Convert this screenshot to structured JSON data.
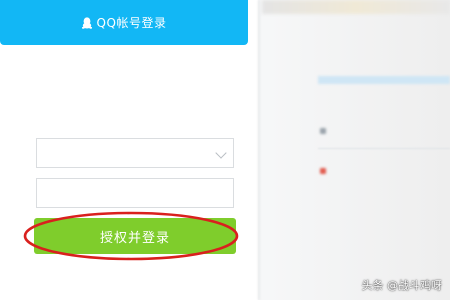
{
  "header": {
    "title": "QQ帐号登录"
  },
  "form": {
    "app_title": "",
    "auth_prefix": "",
    "auth_link": "",
    "auth_suffix": "",
    "account_placeholder": "",
    "password_placeholder": "",
    "login_button_label": "授权并登录"
  },
  "footer": {
    "links": [
      "",
      "",
      ""
    ]
  },
  "right_panel": {
    "line1": "",
    "line2": "",
    "line3": ""
  },
  "watermark": {
    "text": "头条 @战斗鸡呀"
  },
  "colors": {
    "header_blue": "#12b7f5",
    "button_green": "#7fcd2c",
    "annotation_red": "#d9201e"
  },
  "icons": {
    "header_icon": "qq-penguin-icon"
  }
}
